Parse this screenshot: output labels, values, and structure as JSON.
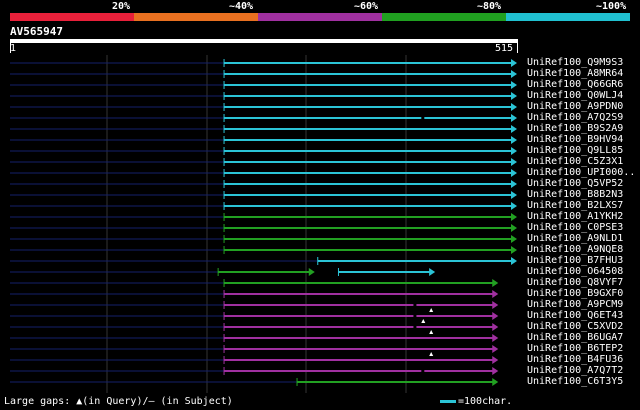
{
  "legend": {
    "labels": [
      "20%",
      "~40%",
      "~60%",
      "~80%",
      "~100%"
    ],
    "colors": [
      "#e8203a",
      "#e87020",
      "#a030a0",
      "#20a020",
      "#20c0d0"
    ]
  },
  "query": {
    "id": "AV565947",
    "start": "1",
    "end": "515",
    "length": 515
  },
  "hits": [
    {
      "name": "UniRef100_Q9M9S3",
      "color": "#2bc4d6",
      "start": 218,
      "end": 515
    },
    {
      "name": "UniRef100_A8MR64",
      "color": "#2bc4d6",
      "start": 218,
      "end": 515
    },
    {
      "name": "UniRef100_Q66GR6",
      "color": "#2bc4d6",
      "start": 218,
      "end": 515
    },
    {
      "name": "UniRef100_Q0WLJ4",
      "color": "#2bc4d6",
      "start": 218,
      "end": 515
    },
    {
      "name": "UniRef100_A9PDN0",
      "color": "#2bc4d6",
      "start": 218,
      "end": 515
    },
    {
      "name": "UniRef100_A7Q2S9",
      "color": "#2bc4d6",
      "start": 218,
      "end": 515,
      "mark": 418
    },
    {
      "name": "UniRef100_B9S2A9",
      "color": "#2bc4d6",
      "start": 218,
      "end": 515
    },
    {
      "name": "UniRef100_B9HV94",
      "color": "#2bc4d6",
      "start": 218,
      "end": 515
    },
    {
      "name": "UniRef100_Q9LL85",
      "color": "#2bc4d6",
      "start": 218,
      "end": 515
    },
    {
      "name": "UniRef100_C5Z3X1",
      "color": "#2bc4d6",
      "start": 218,
      "end": 515
    },
    {
      "name": "UniRef100_UPI000..",
      "color": "#2bc4d6",
      "start": 218,
      "end": 515
    },
    {
      "name": "UniRef100_Q5VP52",
      "color": "#2bc4d6",
      "start": 218,
      "end": 515
    },
    {
      "name": "UniRef100_B8B2N3",
      "color": "#2bc4d6",
      "start": 218,
      "end": 515
    },
    {
      "name": "UniRef100_B2LXS7",
      "color": "#2bc4d6",
      "start": 218,
      "end": 515
    },
    {
      "name": "UniRef100_A1YKH2",
      "color": "#22a022",
      "start": 218,
      "end": 515
    },
    {
      "name": "UniRef100_C0PSE3",
      "color": "#22a022",
      "start": 218,
      "end": 515
    },
    {
      "name": "UniRef100_A9NLD1",
      "color": "#22a022",
      "start": 218,
      "end": 515
    },
    {
      "name": "UniRef100_A9NQE8",
      "color": "#22a022",
      "start": 218,
      "end": 515
    },
    {
      "name": "UniRef100_B7FHU3",
      "color": "#2bc4d6",
      "start": 313,
      "end": 515
    },
    {
      "name": "UniRef100_O64508",
      "color": "#22a022",
      "start": 212,
      "end": 310,
      "extra": {
        "color": "#2bc4d6",
        "start": 334,
        "end": 432
      }
    },
    {
      "name": "UniRef100_Q8VYF7",
      "color": "#22a022",
      "start": 218,
      "end": 496
    },
    {
      "name": "UniRef100_B9GXF0",
      "color": "#a030a0",
      "start": 218,
      "end": 496
    },
    {
      "name": "UniRef100_A9PCM9",
      "color": "#a030a0",
      "start": 218,
      "end": 496,
      "mark": 410
    },
    {
      "name": "UniRef100_Q6ET43",
      "color": "#a030a0",
      "start": 218,
      "end": 496,
      "mark": 410,
      "tri": 428
    },
    {
      "name": "UniRef100_C5XVD2",
      "color": "#a030a0",
      "start": 218,
      "end": 496,
      "mark": 410,
      "tri": 420
    },
    {
      "name": "UniRef100_B6UGA7",
      "color": "#a030a0",
      "start": 218,
      "end": 496,
      "tri": 428
    },
    {
      "name": "UniRef100_B6TEP2",
      "color": "#a030a0",
      "start": 218,
      "end": 496
    },
    {
      "name": "UniRef100_B4FU36",
      "color": "#a030a0",
      "start": 218,
      "end": 496,
      "tri": 428
    },
    {
      "name": "UniRef100_A7Q7T2",
      "color": "#a030a0",
      "start": 218,
      "end": 496,
      "mark": 418
    },
    {
      "name": "UniRef100_C6T3Y5",
      "color": "#22a022",
      "start": 292,
      "end": 496
    }
  ],
  "footer": {
    "text": "Large gaps: ▲(in Query)/– (in Subject)",
    "scale": "=100char."
  }
}
